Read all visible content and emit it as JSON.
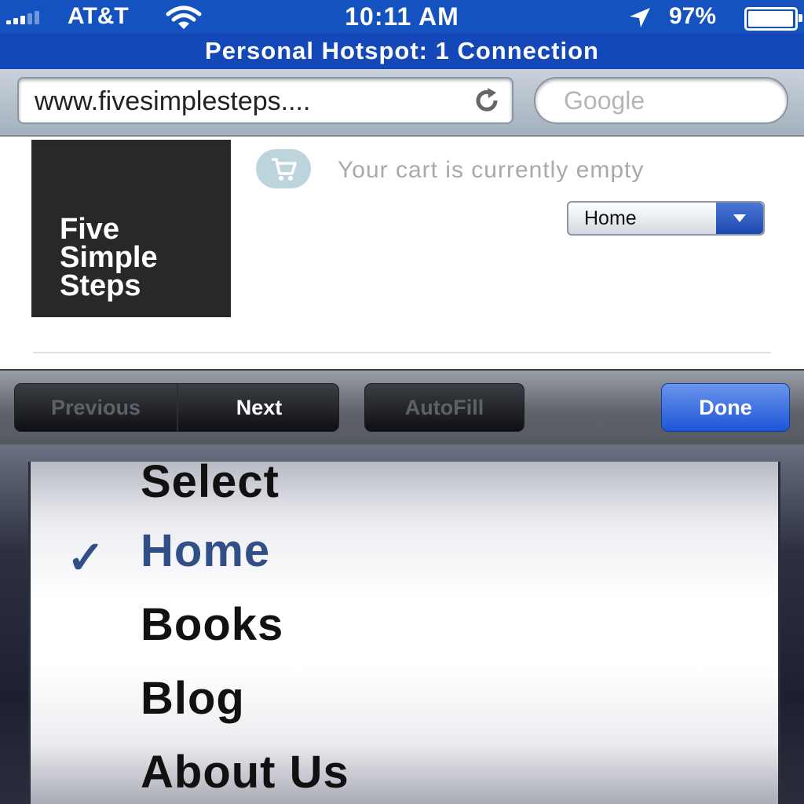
{
  "status_bar": {
    "carrier": "AT&T",
    "time": "10:11 AM",
    "battery_percent": "97%",
    "battery_level": 0.97,
    "icons": [
      "signal-icon",
      "wifi-icon",
      "location-arrow-icon",
      "battery-icon"
    ]
  },
  "hotspot_banner": "Personal Hotspot: 1 Connection",
  "browser": {
    "url": "www.fivesimplesteps....",
    "search_placeholder": "Google"
  },
  "page": {
    "logo_text": "Five\nSimple\nSteps",
    "cart_text": "Your cart is currently empty",
    "nav_select_value": "Home"
  },
  "toolbar": {
    "previous": "Previous",
    "next": "Next",
    "autofill": "AutoFill",
    "done": "Done"
  },
  "picker": {
    "options": [
      "Select",
      "Home",
      "Books",
      "Blog",
      "About Us"
    ],
    "selected": "Home",
    "check": "✓"
  },
  "colors": {
    "status_bar": "#1452c0",
    "done_button": "#1e55d6",
    "selected_option": "#2f4f86"
  }
}
